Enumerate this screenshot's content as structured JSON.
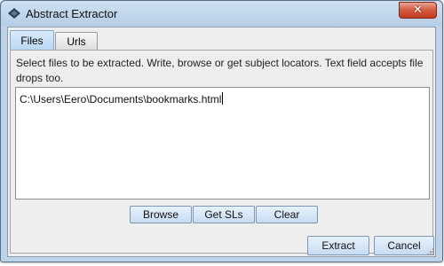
{
  "window": {
    "title": "Abstract Extractor",
    "close_symbol": "✕",
    "icon": "app-logo-icon"
  },
  "tabs": [
    {
      "label": "Files",
      "active": true
    },
    {
      "label": "Urls",
      "active": false
    }
  ],
  "files_panel": {
    "description": "Select files to be extracted. Write, browse or get subject locators. Text field accepts file drops too.",
    "text_value": "C:\\Users\\Eero\\Documents\\bookmarks.html",
    "buttons": {
      "browse": "Browse",
      "get_sls": "Get SLs",
      "clear": "Clear"
    }
  },
  "footer": {
    "extract": "Extract",
    "cancel": "Cancel"
  },
  "colors": {
    "title_bar": "#bcd3ea",
    "close_button": "#c94a33",
    "button_face": "#c7dcf1"
  }
}
